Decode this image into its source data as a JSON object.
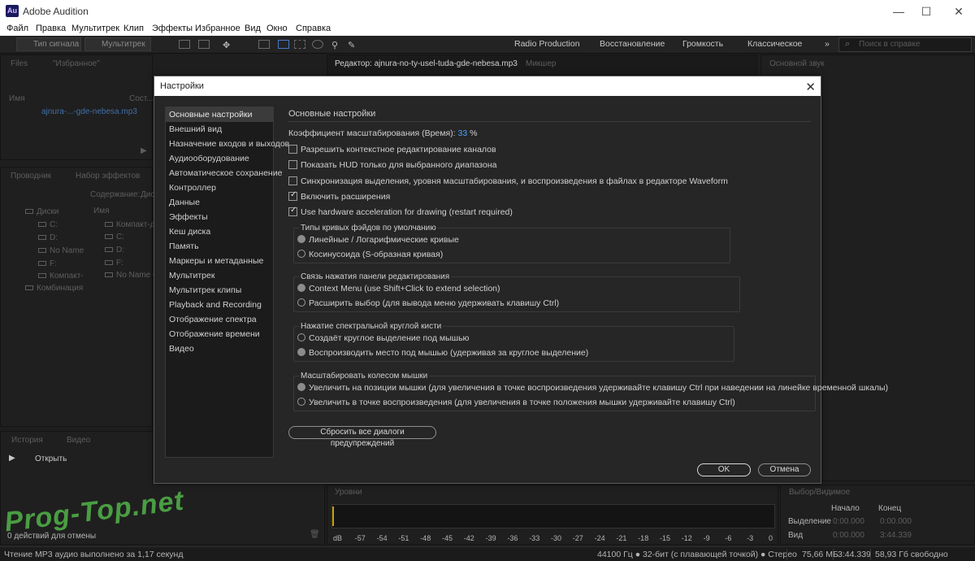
{
  "window": {
    "title": "Adobe Audition",
    "app_icon": "Au",
    "controls": {
      "minimize": "—",
      "maximize": "☐",
      "close": "✕"
    }
  },
  "menu": [
    "Файл",
    "Правка",
    "Мультитрек",
    "Клип",
    "Эффекты",
    "Избранное",
    "Вид",
    "Окно",
    "Справка"
  ],
  "toolbar": {
    "waveform_label": "Тип сигнала",
    "multitrack_label": "Мультитрек",
    "workspaces": [
      "Radio Production",
      "Восстановление",
      "Громкость",
      "Классическое"
    ],
    "more": "»",
    "search_placeholder": "Поиск в справке"
  },
  "files_panel": {
    "tabs": [
      "Files",
      "\"Избранное\""
    ],
    "col_name": "Имя",
    "col_status": "Сост...",
    "file": "ajnura-...-gde-nebesa.mp3"
  },
  "explorer_panel": {
    "tabs": [
      "Проводник",
      "Набор эффектов"
    ],
    "content_label": "Содержание:",
    "content_value": "Дис",
    "col_name": "Имя",
    "tree": [
      "Диски",
      "C:",
      "D:",
      "No Name",
      "F:",
      "Компакт-",
      "Комбинация"
    ],
    "list": [
      "Компакт-д",
      "C:",
      "D:",
      "F:",
      "No Name C"
    ]
  },
  "history_panel": {
    "tabs": [
      "История",
      "Видео"
    ],
    "item": "Открыть",
    "undo_status": "0 действий для отмены"
  },
  "editor": {
    "tab": "Редактор: ajnura-no-ty-usel-tuda-gde-nebesa.mp3",
    "mixer_tab": "Микшер"
  },
  "essential_sound": {
    "title": "Основной звук"
  },
  "levels": {
    "title": "Уровни",
    "ticks": [
      "dB",
      "-57",
      "-54",
      "-51",
      "-48",
      "-45",
      "-42",
      "-39",
      "-36",
      "-33",
      "-30",
      "-27",
      "-24",
      "-21",
      "-18",
      "-15",
      "-12",
      "-9",
      "-6",
      "-3",
      "0"
    ]
  },
  "selection_panel": {
    "title": "Выбор/Видимое",
    "col_start": "Начало",
    "col_end": "Конец",
    "row_selection": "Выделение",
    "row_view": "Вид",
    "sel_start": "0:00.000",
    "sel_end": "0:00.000",
    "view_start": "0:00.000",
    "view_end": "3:44.339"
  },
  "dialog": {
    "title": "Настройки",
    "close": "✕",
    "nav": [
      "Основные настройки",
      "Внешний вид",
      "Назначение входов и выходов",
      "Аудиооборудование",
      "Автоматическое сохранение",
      "Контроллер",
      "Данные",
      "Эффекты",
      "Кеш диска",
      "Память",
      "Маркеры и метаданные",
      "Мультитрек",
      "Мультитрек клипы",
      "Playback and Recording",
      "Отображение спектра",
      "Отображение времени",
      "Видео"
    ],
    "active_nav": 0,
    "section_title": "Основные настройки",
    "zoom_label": "Коэффициент масштабирования (Время):",
    "zoom_value": "33",
    "zoom_unit": "%",
    "checkboxes": [
      {
        "label": "Разрешить контекстное редактирование каналов",
        "checked": false
      },
      {
        "label": "Показать HUD только для выбранного диапазона",
        "checked": false
      },
      {
        "label": "Синхронизация выделения, уровня масштабирования, и воспроизведения в файлах в редакторе Waveform",
        "checked": false
      },
      {
        "label": "Включить расширения",
        "checked": true
      },
      {
        "label": "Use hardware acceleration for drawing (restart required)",
        "checked": true
      }
    ],
    "groups": [
      {
        "title": "Типы кривых фэйдов по умолчанию",
        "options": [
          "Линейные / Логарифмические кривые",
          "Косинусоида (S-образная кривая)"
        ],
        "selected": 0
      },
      {
        "title": "Связь нажатия панели редактирования",
        "options": [
          "Context Menu (use Shift+Click to extend selection)",
          "Расширить выбор (для вывода меню удерживать клавишу Ctrl)"
        ],
        "selected": 0
      },
      {
        "title": "Нажатие спектральной круглой кисти",
        "options": [
          "Создаёт круглое выделение под мышью",
          "Воспроизводить место под мышью (удерживая за круглое выделение)"
        ],
        "selected": 1
      },
      {
        "title": "Масштабировать колесом мышки",
        "options": [
          "Увеличить на позиции мышки (для увеличения в точке воспроизведения удерживайте клавишу Ctrl при наведении на линейке временной шкалы)",
          "Увеличить в точке воспроизведения (для увеличения в точке положения мышки удерживайте клавишу Ctrl)"
        ],
        "selected": 0
      }
    ],
    "reset_button": "Сбросить все диалоги предупреждений",
    "ok_button": "OK",
    "cancel_button": "Отмена"
  },
  "status": {
    "message": "Чтение MP3 аудио выполнено за 1,17 секунд",
    "format": "44100 Гц ● 32-бит (с плавающей точкой) ● Стерео",
    "size": "75,66 МБ",
    "duration": "3:44.339",
    "free": "58,93 Гб свободно"
  },
  "watermark": "Prog-Top.net"
}
